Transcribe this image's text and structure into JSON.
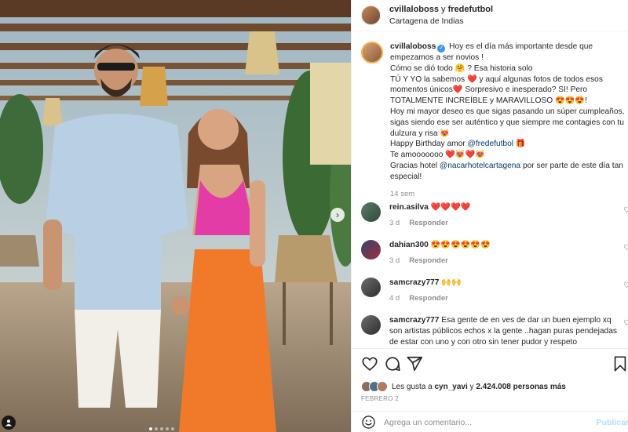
{
  "header": {
    "user1": "cvillaloboss",
    "sep": "y",
    "user2": "fredefutbol",
    "location": "Cartagena de Indias"
  },
  "caption": {
    "user": "cvillaloboss",
    "lines": [
      "Hoy es el día más importante desde que empezamos a ser novios !",
      "Cómo se dió todo 🤗 ? Esa historia solo",
      "TÚ Y YO la sabemos ❤️ y aquí algunas fotos de todos esos momentos únicos❤️ Sorpresivo e inesperado? SI! Pero TOTALMENTE INCREÍBLE y MARAVILLOSO 😍😍😍!",
      "Hoy mi mayor deseo es que sigas pasando un súper cumpleaños, sigas siendo ese ser auténtico y que siempre me contagies con tu dulzura y risa 😻",
      "Happy Birthday amor",
      "Te amooooooo ❤️😻❤️😻",
      "Gracias hotel"
    ],
    "mention1": "@fredefutbol",
    "mention2": "@nacarhotelcartagena",
    "line5_suffix": "🎁",
    "line7_suffix": "por ser parte de este día tan especial!",
    "time": "14 sem"
  },
  "comments": [
    {
      "user": "rein.asilva",
      "text": "❤️❤️❤️❤️",
      "time": "3 d",
      "reply": "Responder"
    },
    {
      "user": "dahian300",
      "text": "😍😍😍😍😍😍",
      "time": "3 d",
      "reply": "Responder"
    },
    {
      "user": "samcrazy777",
      "text": "🙌🙌",
      "time": "4 d",
      "reply": "Responder"
    },
    {
      "user": "samcrazy777",
      "text": "Esa gente de en ves de dar un buen ejemplo xq son artistas públicos echos x la gente ..hagan puras pendejadas de estar con uno y con otro sin tener pudor y respeto",
      "time": "",
      "reply": ""
    }
  ],
  "likes": {
    "prefix": "Les gusta a",
    "user": "cyn_yavi",
    "mid": "y",
    "count": "2.424.008 personas más"
  },
  "date": "FEBRERO 2",
  "composer": {
    "placeholder": "Agrega un comentario...",
    "post_label": "Publicar"
  },
  "icons": {
    "like": "heart-icon",
    "comment": "comment-icon",
    "share": "paper-plane-icon",
    "save": "bookmark-icon",
    "emoji": "smiley-icon",
    "next": "chevron-right-icon",
    "tags": "user-tag-icon"
  },
  "colors": {
    "verified": "#3897f0",
    "mention": "#00376b",
    "post_disabled": "#b2dffc",
    "muted": "#8e8e8e"
  }
}
